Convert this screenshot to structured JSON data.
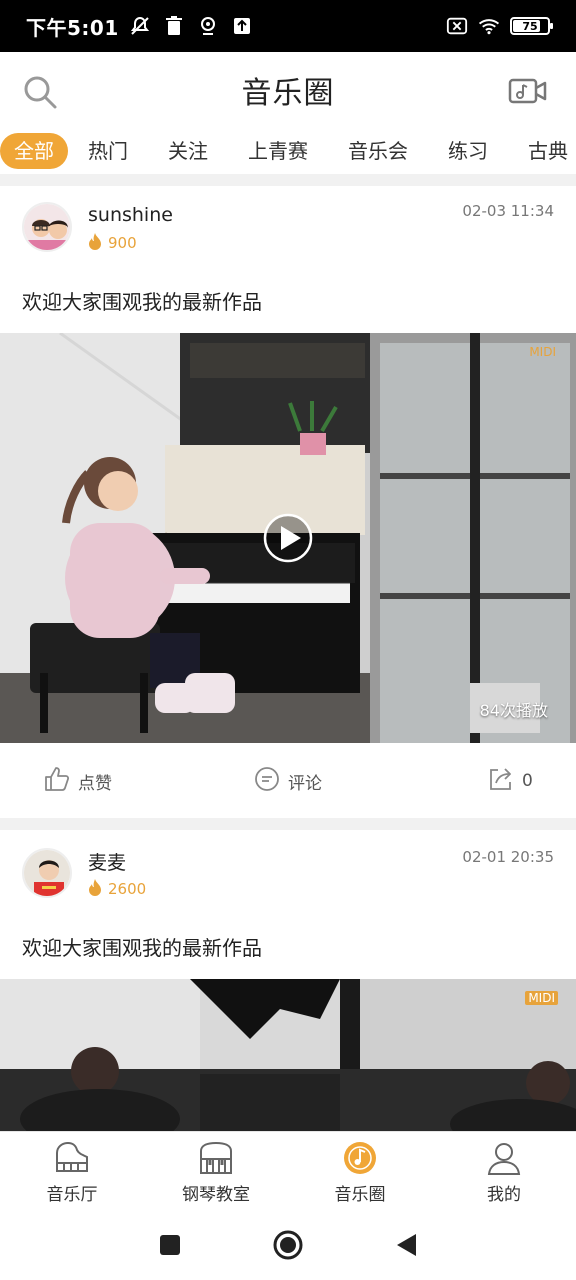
{
  "status_bar": {
    "time": "下午5:01",
    "battery_level": "75"
  },
  "header": {
    "title": "音乐圈"
  },
  "tabs": [
    {
      "label": "全部",
      "active": true
    },
    {
      "label": "热门"
    },
    {
      "label": "关注"
    },
    {
      "label": "上青赛"
    },
    {
      "label": "音乐会"
    },
    {
      "label": "练习"
    },
    {
      "label": "古典"
    }
  ],
  "posts": [
    {
      "username": "sunshine",
      "heat": "900",
      "time": "02-03 11:34",
      "text": "欢迎大家围观我的最新作品",
      "badge": "MIDI",
      "plays": "84次播放",
      "like_label": "点赞",
      "comment_label": "评论",
      "share_count": "0"
    },
    {
      "username": "麦麦",
      "heat": "2600",
      "time": "02-01 20:35",
      "text": "欢迎大家围观我的最新作品",
      "badge": "MIDI"
    }
  ],
  "bottom_nav": [
    {
      "label": "音乐厅",
      "icon": "grand-piano-icon"
    },
    {
      "label": "钢琴教室",
      "icon": "upright-piano-icon"
    },
    {
      "label": "音乐圈",
      "icon": "music-circle-icon",
      "active": true
    },
    {
      "label": "我的",
      "icon": "person-icon"
    }
  ],
  "colors": {
    "accent": "#f0a637",
    "heat": "#e8a33a",
    "separator": "#f1f1f1"
  }
}
